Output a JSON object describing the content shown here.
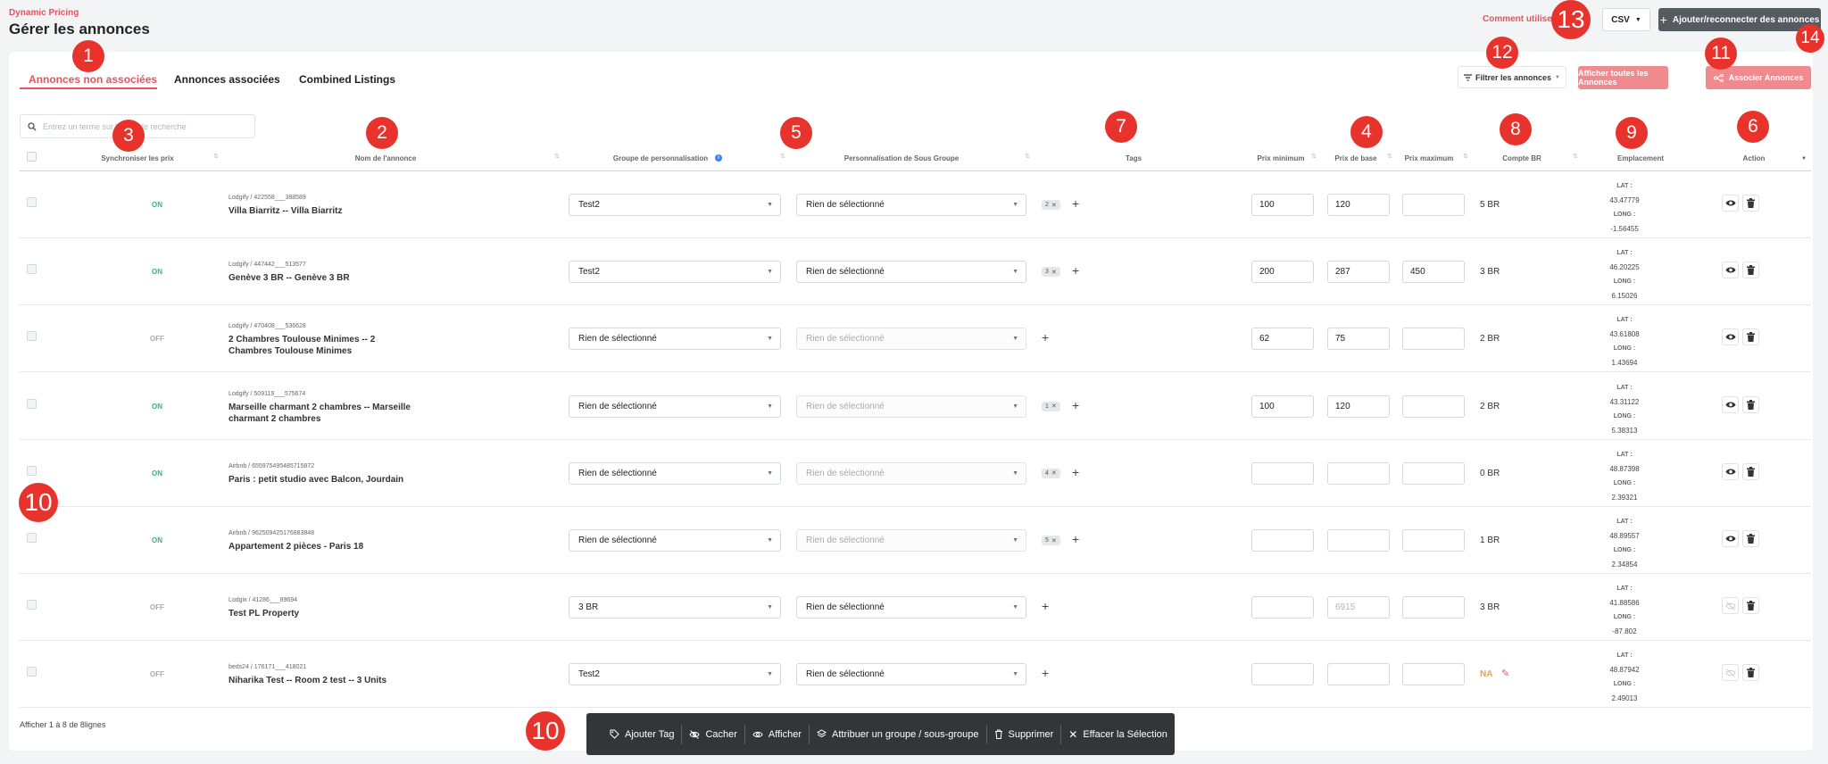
{
  "header": {
    "brand": "Dynamic Pricing",
    "title": "Gérer les annonces",
    "how_to": "Comment utiliser",
    "csv_label": "CSV",
    "add_button": "Ajouter/reconnecter des annonces"
  },
  "tabs": [
    "Annonces non associées",
    "Annonces associées",
    "Combined Listings"
  ],
  "toolbar": {
    "filter": "Filtrer les annonces",
    "show_all": "Afficher toutes les Annonces",
    "associate": "Associer Annonces"
  },
  "search": {
    "placeholder": "Entrez un terme sur lequel de recherche"
  },
  "columns": {
    "sync": "Synchroniser les prix",
    "name": "Nom de l'annonce",
    "group": "Groupe de personnalisation",
    "subgroup": "Personnalisation de Sous Groupe",
    "tags": "Tags",
    "min": "Prix minimum",
    "base": "Prix de base",
    "max": "Prix maximum",
    "br": "Compte BR",
    "location": "Emplacement",
    "action": "Action"
  },
  "labels": {
    "lat": "LAT :",
    "long": "LONG :"
  },
  "rows": [
    {
      "sync": "ON",
      "source": "Lodgify / 422558___388589",
      "name": "Villa Biarritz -- Villa Biarritz",
      "group": "Test2",
      "subgroup": "Rien de sélectionné",
      "tag": "2",
      "min": "100",
      "base": "120",
      "max": "",
      "br": "5 BR",
      "lat": "43.47779",
      "long": "-1.56455"
    },
    {
      "sync": "ON",
      "source": "Lodgify / 447442___513577",
      "name": "Genève 3 BR -- Genève 3 BR",
      "group": "Test2",
      "subgroup": "Rien de sélectionné",
      "tag": "3",
      "min": "200",
      "base": "287",
      "max": "450",
      "br": "3 BR",
      "lat": "46.20225",
      "long": "6.15026"
    },
    {
      "sync": "OFF",
      "source": "Lodgify / 470408___536628",
      "name": "2 Chambres Toulouse Minimes -- 2 Chambres Toulouse Minimes",
      "group": "Rien de sélectionné",
      "subgroup": "Rien de sélectionné",
      "tag": "",
      "min": "62",
      "base": "75",
      "max": "",
      "br": "2 BR",
      "lat": "43.61808",
      "long": "1.43694"
    },
    {
      "sync": "ON",
      "source": "Lodgify / 509119___575674",
      "name": "Marseille charmant 2 chambres -- Marseille charmant 2 chambres",
      "group": "Rien de sélectionné",
      "subgroup": "Rien de sélectionné",
      "tag": "1",
      "min": "100",
      "base": "120",
      "max": "",
      "br": "2 BR",
      "lat": "43.31122",
      "long": "5.38313"
    },
    {
      "sync": "ON",
      "source": "Airbnb / 655975495485715872",
      "name": "Paris : petit studio avec Balcon, Jourdain",
      "group": "Rien de sélectionné",
      "subgroup": "Rien de sélectionné",
      "tag": "4",
      "min": "",
      "base": "",
      "max": "",
      "br": "0 BR",
      "lat": "48.87398",
      "long": "2.39321"
    },
    {
      "sync": "ON",
      "source": "Airbnb / 962509425176883848",
      "name": "Appartement 2 pièces - Paris 18",
      "group": "Rien de sélectionné",
      "subgroup": "Rien de sélectionné",
      "tag": "5",
      "min": "",
      "base": "",
      "max": "",
      "br": "1 BR",
      "lat": "48.89557",
      "long": "2.34854"
    },
    {
      "sync": "OFF",
      "source": "Lodgix / 41286___89694",
      "name": "Test PL Property",
      "group": "3 BR",
      "subgroup": "Rien de sélectionné",
      "tag": "",
      "min": "",
      "base": "6915",
      "max": "",
      "br": "3 BR",
      "lat": "41.88586",
      "long": "-87.802"
    },
    {
      "sync": "OFF",
      "source": "beds24 / 176171___418021",
      "name": "Niharika Test -- Room 2 test -- 3 Units",
      "group": "Test2",
      "subgroup": "Rien de sélectionné",
      "tag": "",
      "min": "",
      "base": "",
      "max": "",
      "br": "NA",
      "lat": "48.87942",
      "long": "2.49013"
    }
  ],
  "footer": "Afficher 1 à 8 de 8lignes",
  "bulk": {
    "add_tag": "Ajouter Tag",
    "hide": "Cacher",
    "show": "Afficher",
    "assign": "Attribuer un groupe / sous-groupe",
    "delete": "Supprimer",
    "clear": "Effacer la Sélection"
  },
  "badges": [
    "1",
    "2",
    "3",
    "4",
    "5",
    "6",
    "7",
    "8",
    "9",
    "10",
    "10",
    "11",
    "12",
    "13",
    "14"
  ],
  "colors": {
    "accent": "#e5545e",
    "on": "#36b37e",
    "badge": "#e8322c",
    "bar": "#333639"
  }
}
